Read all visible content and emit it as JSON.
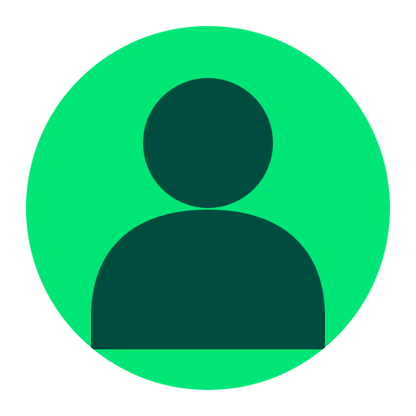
{
  "avatar": {
    "icon": "user-icon",
    "colors": {
      "background": "#ffffff",
      "circle": "#00e676",
      "figure": "#004d40"
    }
  }
}
